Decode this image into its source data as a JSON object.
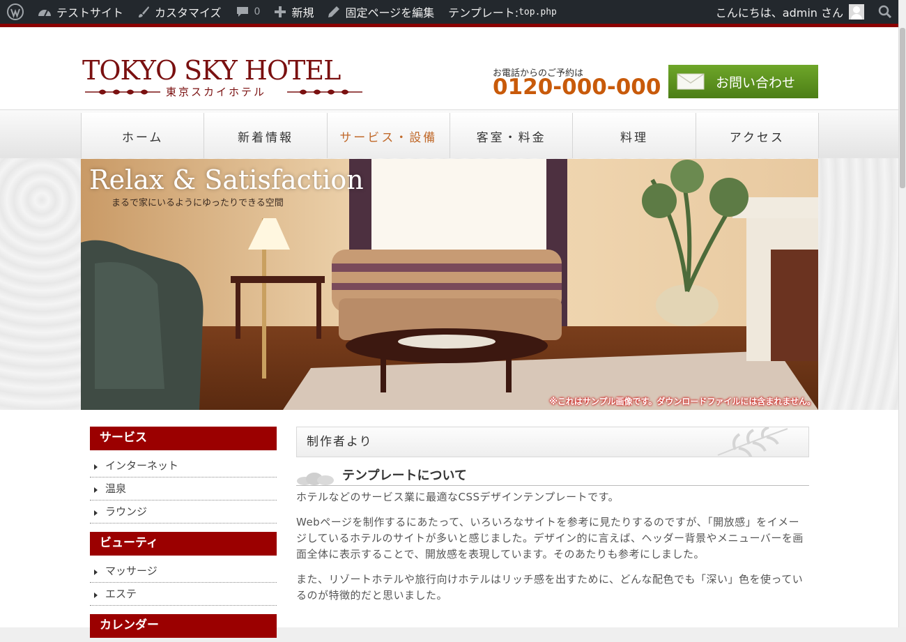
{
  "admin_bar": {
    "site_name": "テストサイト",
    "customize": "カスタマイズ",
    "comments_count": "0",
    "new": "新規",
    "edit_page": "固定ページを編集",
    "template_prefix": "テンプレート:",
    "template_file": "top.php",
    "greeting": "こんにちは、admin さん"
  },
  "header": {
    "logo_text": "TOKYO SKY HOTEL",
    "logo_sub": "東京スカイホテル",
    "phone_label": "お電話からのご予約は",
    "phone": "0120-000-000",
    "contact_button": "お問い合わせ"
  },
  "nav": {
    "items": [
      {
        "label": "ホーム"
      },
      {
        "label": "新着情報"
      },
      {
        "label": "サービス・設備",
        "active": true
      },
      {
        "label": "客室・料金"
      },
      {
        "label": "料理"
      },
      {
        "label": "アクセス"
      }
    ]
  },
  "hero": {
    "title": "Relax & Satisfaction",
    "subtitle": "まるで家にいるようにゆったりできる空間",
    "note": "※これはサンプル画像です。ダウンロードファイルには含まれません。"
  },
  "sidebar": {
    "sections": [
      {
        "heading": "サービス",
        "items": [
          "インターネット",
          "温泉",
          "ラウンジ"
        ]
      },
      {
        "heading": "ビューティ",
        "items": [
          "マッサージ",
          "エステ"
        ]
      },
      {
        "heading": "カレンダー",
        "items": []
      }
    ]
  },
  "main": {
    "heading": "制作者より",
    "subheading": "テンプレートについて",
    "paragraphs": [
      "ホテルなどのサービス業に最適なCSSデザインテンプレートです。",
      "Webページを制作するにあたって、いろいろなサイトを参考に見たりするのですが、「開放感」をイメージしているホテルのサイトが多いと感じました。デザイン的に言えば、ヘッダー背景やメニューバーを画面全体に表示することで、開放感を表現しています。そのあたりも参考にしました。",
      "また、リゾートホテルや旅行向けホテルはリッチ感を出すために、どんな配色でも「深い」色を使っているのが特徴的だと思いました。"
    ]
  },
  "colors": {
    "admin_bar_bg": "#23282d",
    "brand_red": "#9b0000",
    "phone_orange": "#c85a0a",
    "contact_green": "#5b8f1f",
    "nav_active": "#c0692a"
  }
}
